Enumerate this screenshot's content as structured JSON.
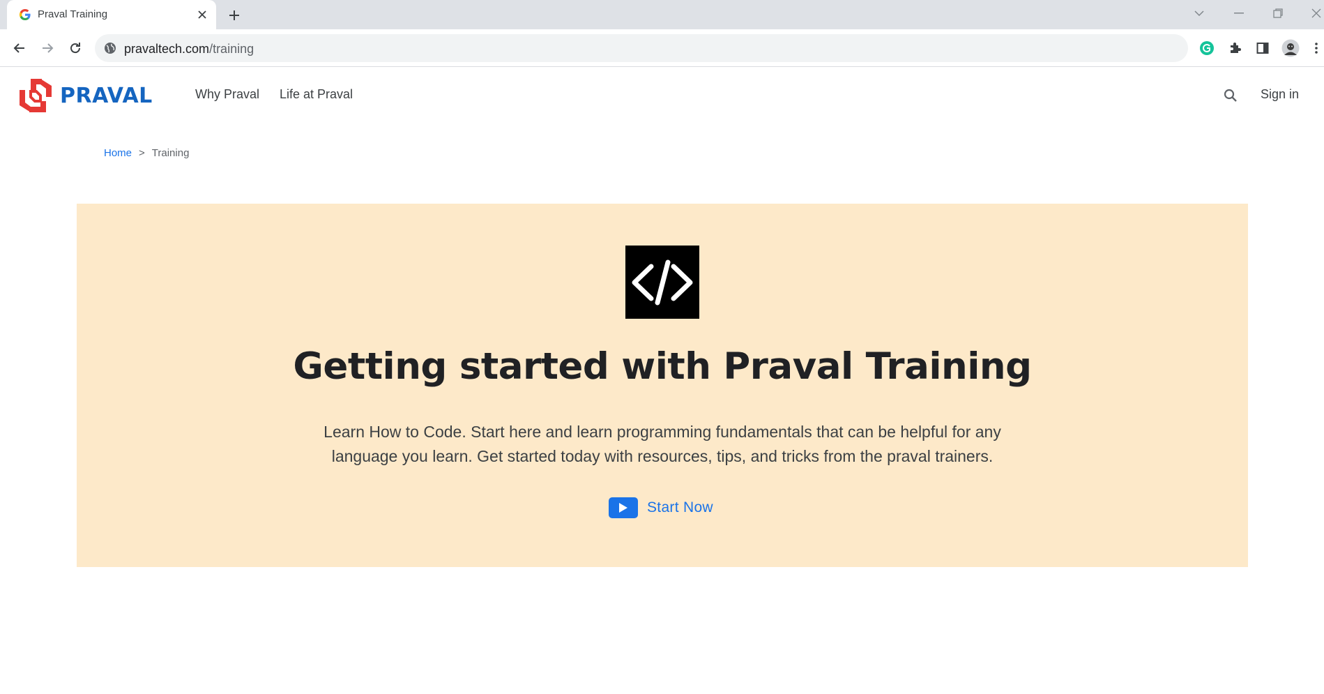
{
  "browser": {
    "tab_title": "Praval Training",
    "url_host": "pravaltech.com",
    "url_path": "/training"
  },
  "header": {
    "logo_text": "PRAVAL",
    "nav": [
      "Why Praval",
      "Life at Praval"
    ],
    "signin_label": "Sign in"
  },
  "breadcrumb": {
    "home": "Home",
    "separator": ">",
    "current": "Training"
  },
  "hero": {
    "title": "Getting started with Praval Training",
    "description": "Learn How to Code. Start here and learn programming fundamentals that can be helpful for any language you learn. Get started today with resources, tips, and tricks from the praval trainers.",
    "cta_label": "Start Now",
    "icon": "code-brackets-icon"
  },
  "colors": {
    "hero_bg": "#fde9c9",
    "accent": "#1a73e8",
    "logo_red": "#e53935",
    "logo_blue": "#1565c0",
    "tabstrip_bg": "#dee1e6"
  }
}
